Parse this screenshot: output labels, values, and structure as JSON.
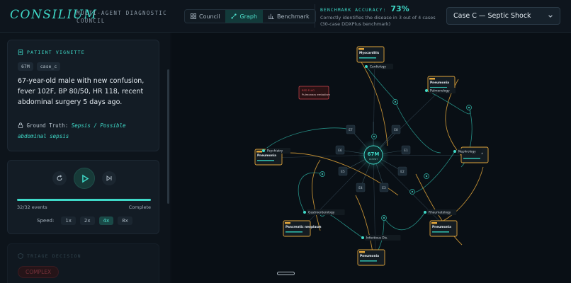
{
  "header": {
    "logo": "CONSILIUM",
    "subtitle": "MULTI-AGENT DIAGNOSTIC COUNCIL",
    "tabs": [
      {
        "label": "Council",
        "icon": "grid-icon",
        "active": false
      },
      {
        "label": "Graph",
        "icon": "graph-icon",
        "active": true
      },
      {
        "label": "Benchmark",
        "icon": "bar-chart-icon",
        "active": false
      }
    ],
    "benchmark": {
      "label": "BENCHMARK ACCURACY:",
      "value": "73%",
      "desc": "Correctly identifies the disease in 3 out of 4 cases (30-case DDXPlus benchmark)"
    },
    "case_select": {
      "value": "Case C — Septic Shock",
      "icon": "chevron-down-icon"
    }
  },
  "vignette": {
    "title": "PATIENT VIGNETTE",
    "chips": [
      "67M",
      "case_c"
    ],
    "text": "67-year-old male with new confusion, fever 102F, BP 80/50, HR 118, recent abdominal surgery 5 days ago.",
    "gt_label": "Ground Truth:",
    "gt_value": "Sepsis / Possible abdominal sepsis"
  },
  "player": {
    "events": "32/32 events",
    "status": "Complete",
    "progress": 1.0,
    "speed_label": "Speed:",
    "speeds": [
      "1x",
      "2x",
      "4x",
      "8x"
    ],
    "active_speed": "4x"
  },
  "triage": {
    "title": "TRIAGE DECISION",
    "badge": "COMPLEX"
  },
  "graph": {
    "center_label": "67M",
    "center_sub": "PATIENT",
    "colors": {
      "accent": "#3fd9c8",
      "amber": "#e0a43a",
      "red": "#d0464e",
      "node": "#1a2833"
    },
    "diagnosis_cards": [
      {
        "name": "Myocarditis",
        "tag": "DX 1"
      },
      {
        "name": "Pneumonia",
        "tag": "DX 2"
      },
      {
        "name": "Pneumonia",
        "tag": "DX 3"
      },
      {
        "name": "Pneumonia",
        "tag": "DX 4"
      },
      {
        "name": "Pancreatic neoplasm",
        "tag": "DX 5"
      },
      {
        "name": "Pneumonia",
        "tag": "DX 6"
      },
      {
        "name": "Pneumonia",
        "tag": "DX 7"
      }
    ],
    "specialists": [
      "Cardiology",
      "Pulmonology",
      "Nephrology",
      "Rheumatology",
      "Infectious Dis.",
      "Gastroenterology",
      "Psychiatry"
    ],
    "red_flag": {
      "title": "RED FLAG",
      "text": "Pulmonary embolism"
    },
    "inner_nodes": [
      "E8",
      "E1",
      "E2",
      "E3",
      "E4",
      "E5",
      "E6",
      "E7"
    ]
  }
}
